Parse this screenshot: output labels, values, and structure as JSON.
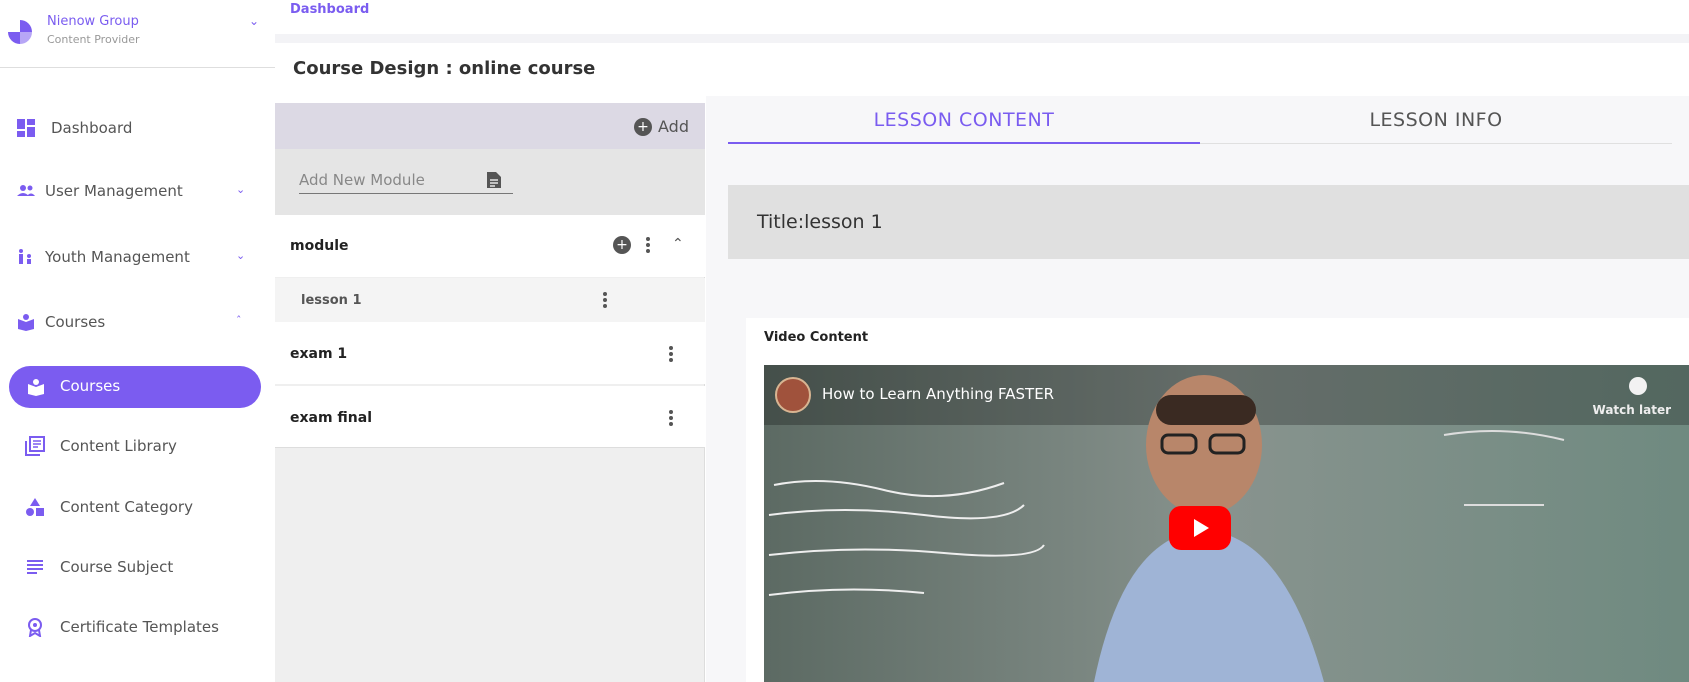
{
  "org": {
    "name": "Nienow Group",
    "role": "Content Provider"
  },
  "sidebar": {
    "items": [
      {
        "label": "Dashboard"
      },
      {
        "label": "User Management"
      },
      {
        "label": "Youth Management"
      },
      {
        "label": "Courses"
      },
      {
        "label": "Courses"
      },
      {
        "label": "Content Library"
      },
      {
        "label": "Content Category"
      },
      {
        "label": "Course Subject"
      },
      {
        "label": "Certificate Templates"
      }
    ]
  },
  "breadcrumb": "Dashboard",
  "page_title": "Course Design : online course",
  "modules_panel": {
    "add_label": "Add",
    "new_module_placeholder": "Add New Module",
    "rows": [
      {
        "label": "module"
      },
      {
        "label": "lesson 1"
      },
      {
        "label": "exam 1"
      },
      {
        "label": "exam final"
      }
    ]
  },
  "tabs": [
    {
      "label": "LESSON CONTENT",
      "active": true
    },
    {
      "label": "LESSON INFO",
      "active": false
    }
  ],
  "lesson": {
    "title": "Title:lesson 1",
    "video_label": "Video Content",
    "video_title": "How to Learn Anything FASTER",
    "watch_later": "Watch later"
  },
  "colors": {
    "accent": "#7b5cf0"
  }
}
